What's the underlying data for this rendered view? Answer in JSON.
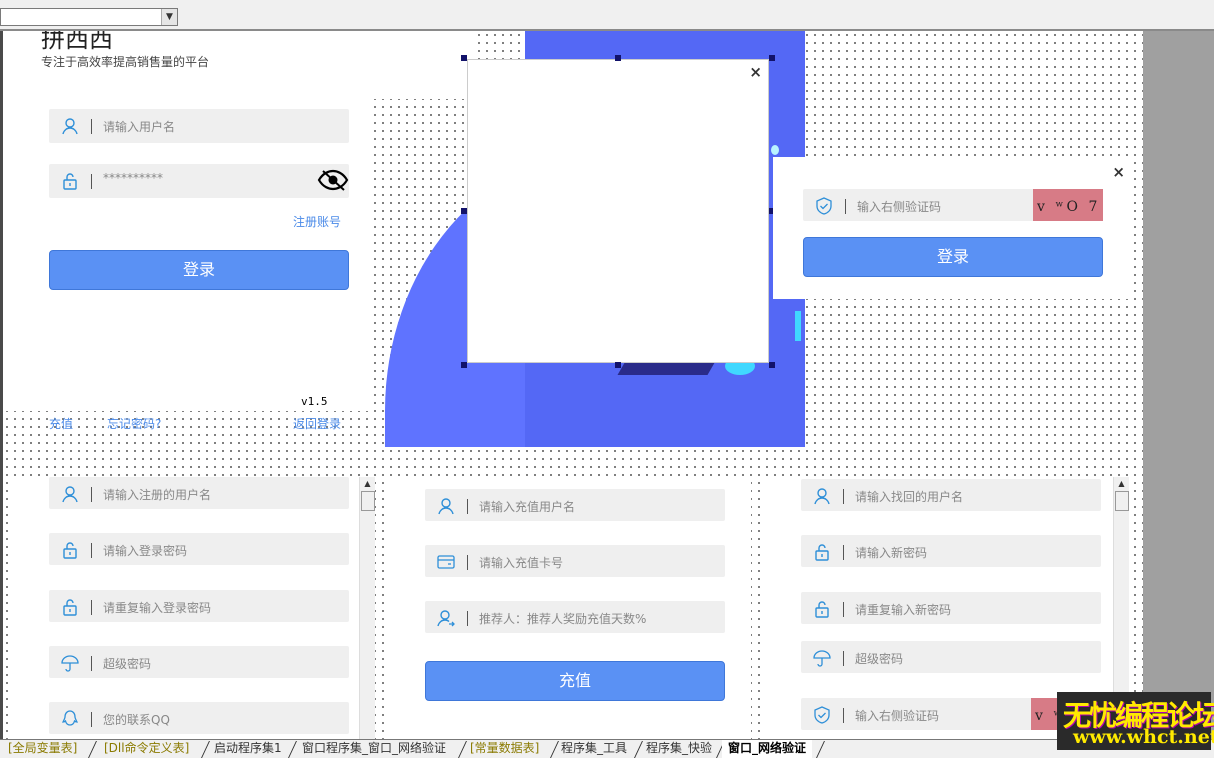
{
  "toolbar": {
    "combo_value": ""
  },
  "login": {
    "title": "拼西西",
    "subtitle": "专注于高效率提高销售量的平台",
    "username_placeholder": "请输入用户名",
    "password_value": "**********",
    "register_link": "注册账号",
    "login_button": "登录",
    "version": "v1.5",
    "recharge_link": "充值",
    "forgot_link": "忘记密码?",
    "back_link": "返回登录"
  },
  "captcha_panel": {
    "captcha_placeholder": "输入右侧验证码",
    "captcha_code": "v ʷO 7",
    "login_button": "登录",
    "close": "×"
  },
  "dialog": {
    "close": "×"
  },
  "register": {
    "username_placeholder": "请输入注册的用户名",
    "password_placeholder": "请输入登录密码",
    "repeat_placeholder": "请重复输入登录密码",
    "super_placeholder": "超级密码",
    "qq_placeholder": "您的联系QQ"
  },
  "recharge": {
    "username_placeholder": "请输入充值用户名",
    "card_placeholder": "请输入充值卡号",
    "referrer_placeholder": "推荐人：推荐人奖励充值天数%",
    "button": "充值"
  },
  "recover": {
    "username_placeholder": "请输入找回的用户名",
    "new_password_placeholder": "请输入新密码",
    "repeat_placeholder": "请重复输入新密码",
    "super_placeholder": "超级密码",
    "captcha_placeholder": "输入右侧验证码",
    "captcha_code": "v ʷ"
  },
  "tabs": [
    {
      "label": "[全局变量表]"
    },
    {
      "label": "[Dll命令定义表]"
    },
    {
      "label": "启动程序集1"
    },
    {
      "label": "窗口程序集_窗口_网络验证"
    },
    {
      "label": "[常量数据表]"
    },
    {
      "label": "程序集_工具"
    },
    {
      "label": "程序集_快验"
    },
    {
      "label": "窗口_网络验证"
    }
  ],
  "watermark": {
    "line1": "无忧编程论坛",
    "line2": "www.whct.net"
  },
  "colors": {
    "accent": "#5a91f4",
    "link": "#4a8ae8",
    "panel_blue": "#5468f5",
    "captcha_bg": "#d77b86"
  }
}
